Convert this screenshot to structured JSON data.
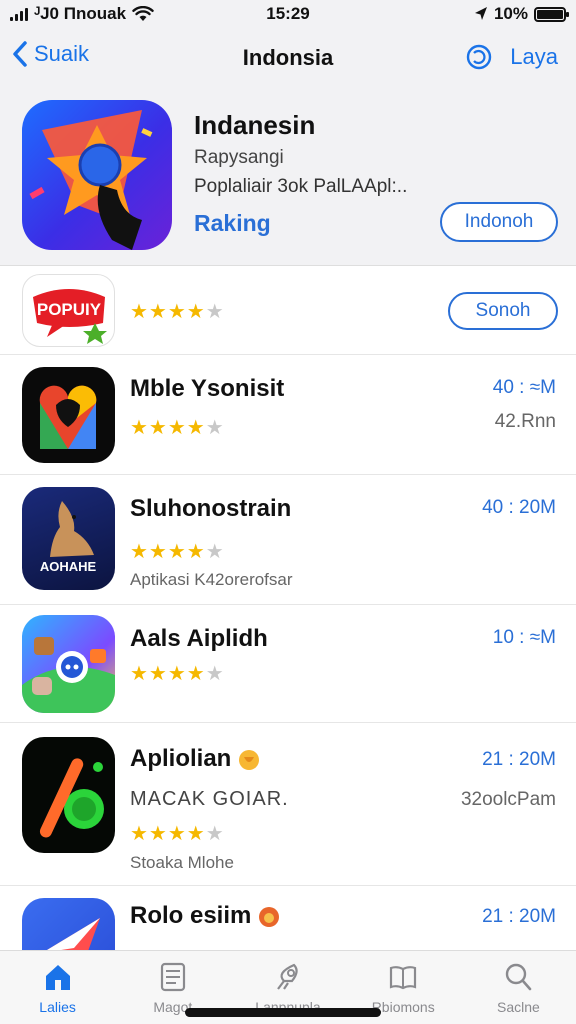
{
  "status_bar": {
    "carrier": "ᴶJ0 Πnouak",
    "time": "15:29",
    "battery": "10%",
    "icons": [
      "signal-icon",
      "wifi-icon",
      "location-icon",
      "battery-icon"
    ]
  },
  "nav": {
    "back_label": "Suaik",
    "title": "Indonsia",
    "right_label": "Laya"
  },
  "featured": {
    "title": "Indanesin",
    "subtitle": "Rapysangi",
    "description": "Poplaliair 3ok PalLAApl:..",
    "category": "Raking",
    "button_label": "Indonoh"
  },
  "apps": [
    {
      "name": "",
      "rating": 4,
      "button_label": "Sonoh",
      "logo_text": "POPUIY"
    },
    {
      "name": "Mble Ysonisit",
      "rating": 4,
      "size": "40 : ≈M",
      "count": "42.Rnn"
    },
    {
      "name": "Sluhonostrain",
      "rating": 4,
      "size": "40 : 20M",
      "meta": "Aptikasi K42orerofsar",
      "logo_text": "AOHAHE"
    },
    {
      "name": "Aals Aiplidh",
      "rating": 4,
      "size": "10 : ≈M"
    },
    {
      "name": "Apliolian",
      "rating": 4,
      "size": "21 : 20M",
      "developer": "MACAK GOIAR.",
      "count": "32oolcPam",
      "meta": "Stoaka Mlohe"
    },
    {
      "name": "Rolo esiim",
      "size": "21 : 20M"
    }
  ],
  "tabs": [
    {
      "label": "Lalies",
      "icon": "home-icon",
      "active": true
    },
    {
      "label": "Magot",
      "icon": "apps-icon"
    },
    {
      "label": "Lanpnupla",
      "icon": "rocket-icon"
    },
    {
      "label": "Rbiomons",
      "icon": "book-icon"
    },
    {
      "label": "Saclne",
      "icon": "search-icon"
    }
  ],
  "colors": {
    "accent": "#1a73e8",
    "star": "#f5b800",
    "header_bg": "#f2f2f4"
  }
}
